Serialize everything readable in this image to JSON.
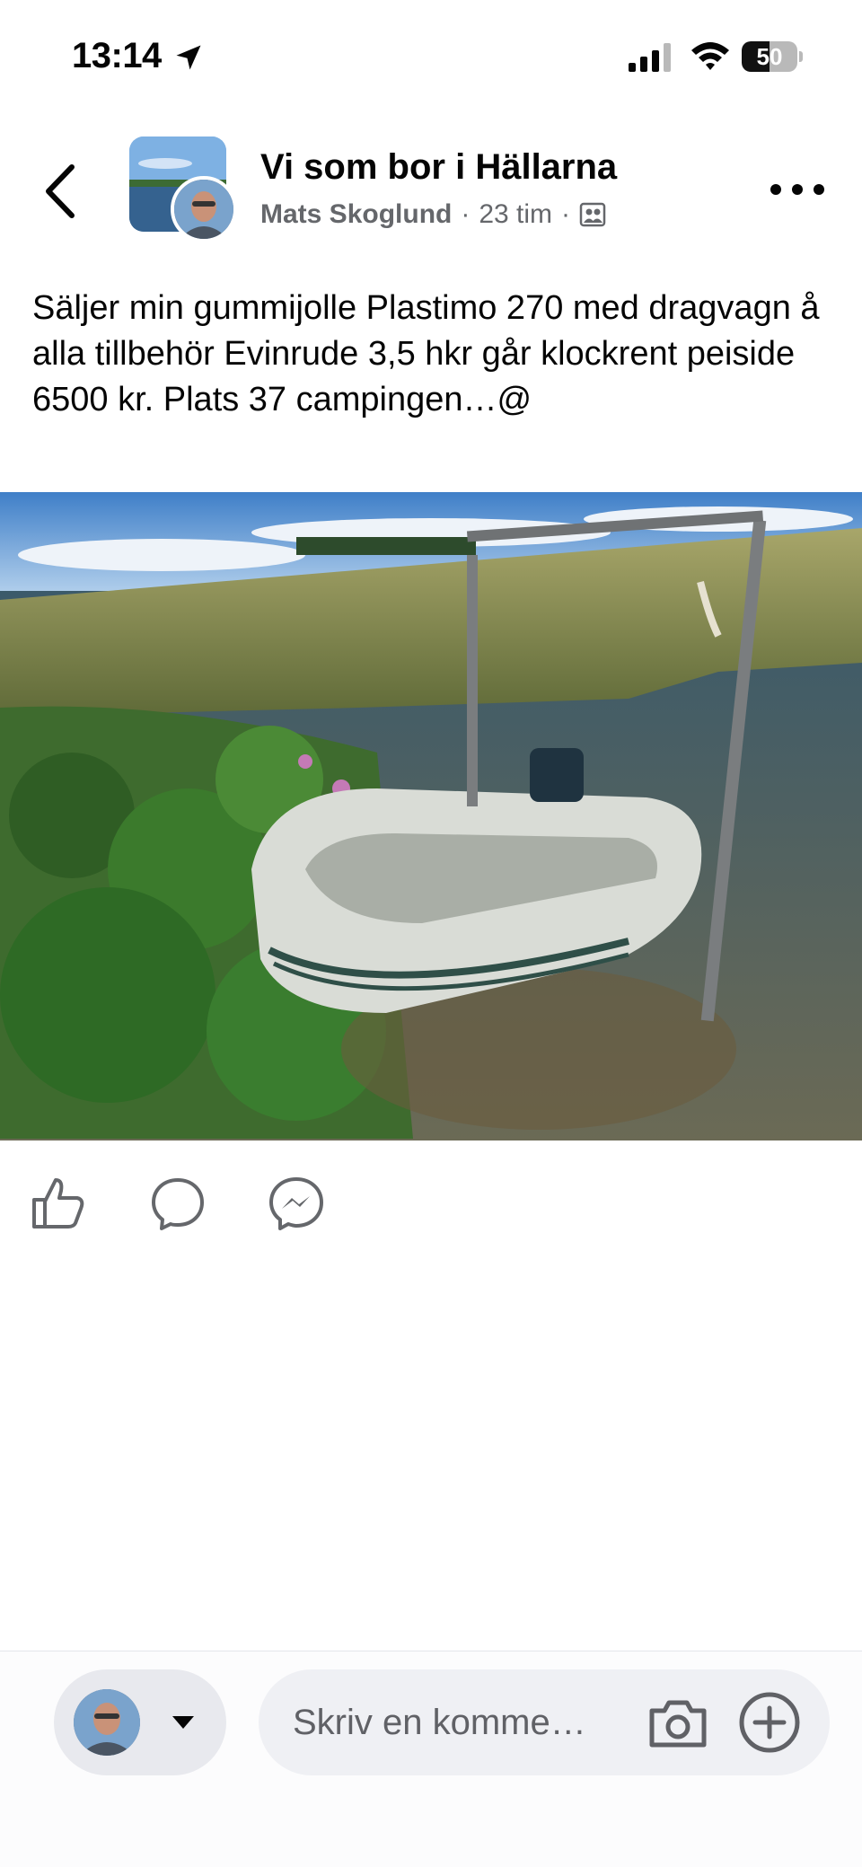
{
  "status_bar": {
    "time": "13:14",
    "battery": "50",
    "battery_level": 0.5
  },
  "header": {
    "group_name": "Vi som bor i Hällarna",
    "author": "Mats Skoglund",
    "separator": "·",
    "time_ago": "23 tim",
    "icons": [
      "back-chevron-icon",
      "group-icon",
      "more-dots-icon"
    ]
  },
  "post": {
    "text": "Säljer min gummijolle Plastimo 270 med dragvagn å alla tillbehör Evinrude 3,5 hkr går klockrent peiside 6500 kr. Plats 37 campingen…@",
    "photo_icon": "photo-dinghy-on-shore"
  },
  "actions": {
    "icons": [
      "like-icon",
      "comment-icon",
      "messenger-share-icon"
    ]
  },
  "composer": {
    "placeholder": "Skriv en komme…",
    "icons": [
      "caret-down-icon",
      "camera-icon",
      "plus-icon"
    ]
  }
}
